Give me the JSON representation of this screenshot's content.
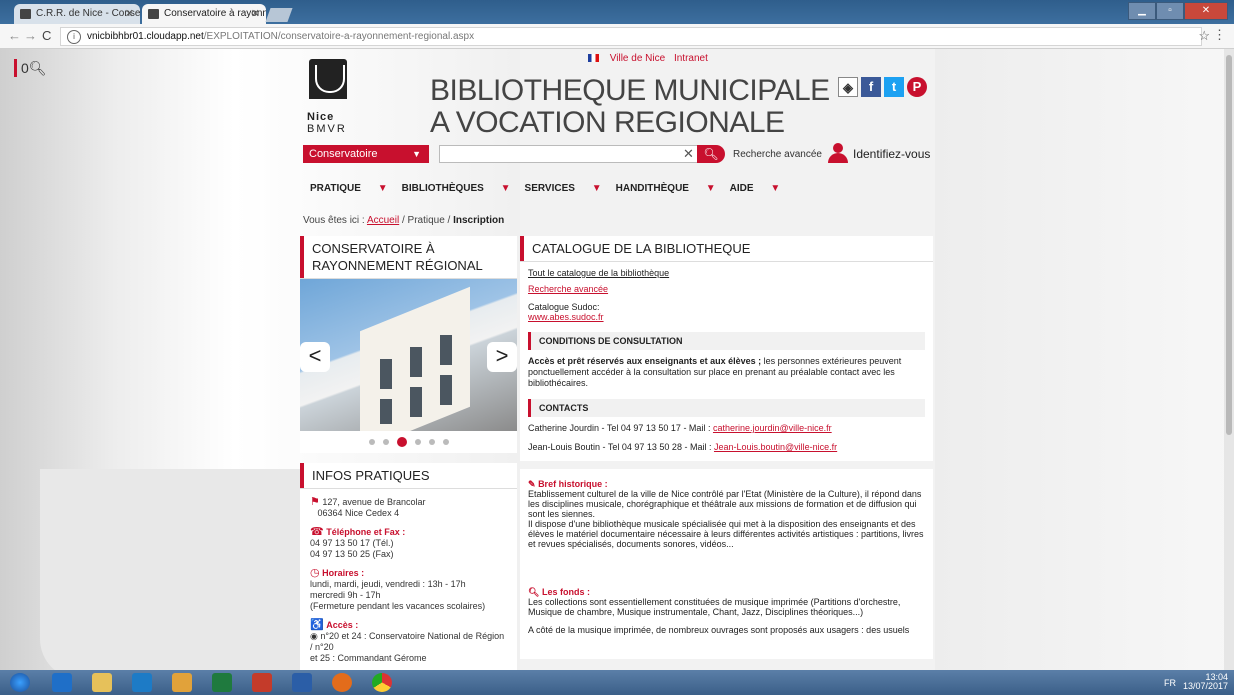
{
  "browser": {
    "tabs": [
      {
        "label": "C.R.R. de Nice - Conserv",
        "active": false
      },
      {
        "label": "Conservatoire à rayonne",
        "active": true
      }
    ],
    "url_host": "vnicbibhbr01.cloudapp.net",
    "url_path": "/EXPLOITATION/conservatoire-a-rayonnement-regional.aspx"
  },
  "page": {
    "counter": "0",
    "toplinks": [
      "Ville de Nice",
      "Intranet"
    ],
    "logo": {
      "line1": "Nice",
      "line2": "BMVR"
    },
    "title_line1": "BIBLIOTHEQUE MUNICIPALE",
    "title_line2": "A VOCATION REGIONALE",
    "search": {
      "category": "Conservatoire",
      "placeholder": "",
      "advanced": "Recherche avancée",
      "login": "Identifiez-vous"
    },
    "nav": [
      "PRATIQUE",
      "BIBLIOTHÈQUES",
      "SERVICES",
      "HANDITHÈQUE",
      "AIDE"
    ],
    "breadcrumb": {
      "prefix": "Vous êtes ici :",
      "home": "Accueil",
      "mid": "/ Pratique /",
      "current": "Inscription"
    },
    "left": {
      "title": "CONSERVATOIRE À RAYONNEMENT RÉGIONAL",
      "prev": "<",
      "next": ">",
      "infos_title": "INFOS PRATIQUES",
      "address1": "127, avenue de Brancolar",
      "address2": "06364 Nice Cedex 4",
      "tel_title": "Téléphone et Fax :",
      "tel1": "04 97 13 50 17 (Tél.)",
      "tel2": "04 97 13 50 25 (Fax)",
      "hours_title": "Horaires :",
      "hours1": "lundi, mardi, jeudi, vendredi : 13h - 17h",
      "hours2": "mercredi 9h - 17h",
      "hours3": "(Fermeture pendant les vacances scolaires)",
      "access_title": "Accès :",
      "access1": "n°20 et 24 : Conservatoire National de Région / n°20",
      "access2": "et 25 : Commandant Gérome"
    },
    "right": {
      "catalog_title": "CATALOGUE DE LA BIBLIOTHEQUE",
      "link_all": "Tout le catalogue de la bibliothèque",
      "link_adv": "Recherche avancée",
      "sudoc_label": "Catalogue Sudoc:",
      "sudoc_link": "www.abes.sudoc.fr",
      "cond_title": "CONDITIONS DE CONSULTATION",
      "cond_bold": "Accès et prêt réservés aux enseignants et aux élèves ;",
      "cond_rest": " les personnes extérieures peuvent ponctuellement accéder à la consultation sur place en prenant au préalable contact avec les bibliothécaires.",
      "contacts_title": "CONTACTS",
      "contact1_text": "Catherine Jourdin - Tel 04 97 13 50 17 - Mail :",
      "contact1_mail": "catherine.jourdin@ville-nice.fr",
      "contact2_text": "Jean-Louis Boutin - Tel 04 97 13 50 28 - Mail :",
      "contact2_mail": "Jean-Louis.boutin@ville-nice.fr",
      "hist_title": "Bref historique :",
      "hist_p1": "Etablissement culturel de la ville de Nice contrôlé par l'Etat (Ministère de la Culture), il répond dans les disciplines musicale, chorégraphique et théâtrale aux missions de formation et de diffusion qui sont les siennes.",
      "hist_p2": "Il dispose d'une bibliothèque musicale spécialisée qui met à la disposition des enseignants et des élèves le matériel documentaire nécessaire à leurs différentes activités artistiques : partitions, livres et revues spécialisés, documents sonores, vidéos...",
      "fonds_title": "Les fonds :",
      "fonds_p1": "Les collections sont essentiellement constituées de musique imprimée (Partitions d'orchestre, Musique de chambre, Musique instrumentale, Chant, Jazz, Disciplines théoriques...)",
      "fonds_p2": "A côté de la musique imprimée, de nombreux ouvrages sont proposés aux usagers : des usuels"
    }
  },
  "taskbar": {
    "lang": "FR",
    "time": "13:04",
    "date": "13/07/2017"
  }
}
